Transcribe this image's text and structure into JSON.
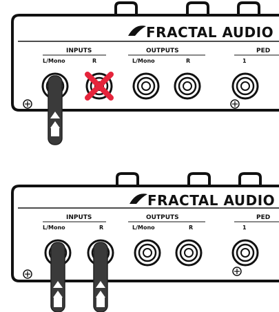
{
  "panels": [
    {
      "id": "panel-top",
      "brand": "FRACTAL AUDIO",
      "inputs_label": "INPUTS",
      "outputs_label": "OUTPUTS",
      "pedal_label": "PED",
      "jack_labels": {
        "in_l": "L/Mono",
        "in_r": "R",
        "out_l": "L/Mono",
        "out_r": "R",
        "pedal_1": "1"
      },
      "cables": [
        "in_l"
      ],
      "crossed": [
        "in_r"
      ]
    },
    {
      "id": "panel-bottom",
      "brand": "FRACTAL AUDIO",
      "inputs_label": "INPUTS",
      "outputs_label": "OUTPUTS",
      "pedal_label": "PED",
      "jack_labels": {
        "in_l": "L/Mono",
        "in_r": "R",
        "out_l": "L/Mono",
        "out_r": "R",
        "pedal_1": "1"
      },
      "cables": [
        "in_l",
        "in_r"
      ],
      "crossed": []
    }
  ],
  "colors": {
    "outline": "#111111",
    "cross": "#e5243b",
    "cable": "#3a3a3a",
    "cable_edge": "#222222",
    "panel": "#ffffff"
  }
}
